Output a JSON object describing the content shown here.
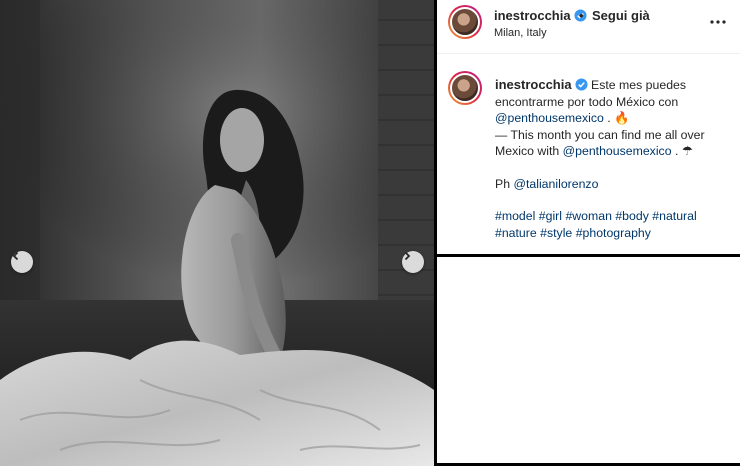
{
  "post": {
    "username": "inestrocchia",
    "separator": "•",
    "follow_label": "Segui già",
    "location": "Milan, Italy"
  },
  "caption": {
    "username": "inestrocchia",
    "line1": "Este mes puedes encontrarme por todo México con",
    "mention1": "@penthousemexico",
    "line1_end": " . 🔥",
    "line2": "— This month you can find me all over Mexico with",
    "mention2": "@penthousemexico",
    "line2_end": " . ☂",
    "credit_prefix": "Ph ",
    "credit_mention": "@talianilorenzo",
    "hashtags": [
      "#model",
      "#girl",
      "#woman",
      "#body",
      "#natural",
      "#nature",
      "#style",
      "#photography"
    ]
  },
  "icons": {
    "verified": "verified-badge-icon",
    "more": "more-options-icon",
    "prev": "chevron-left-icon",
    "next": "chevron-right-icon"
  },
  "colors": {
    "link": "#00376b",
    "verified": "#3897f0"
  }
}
